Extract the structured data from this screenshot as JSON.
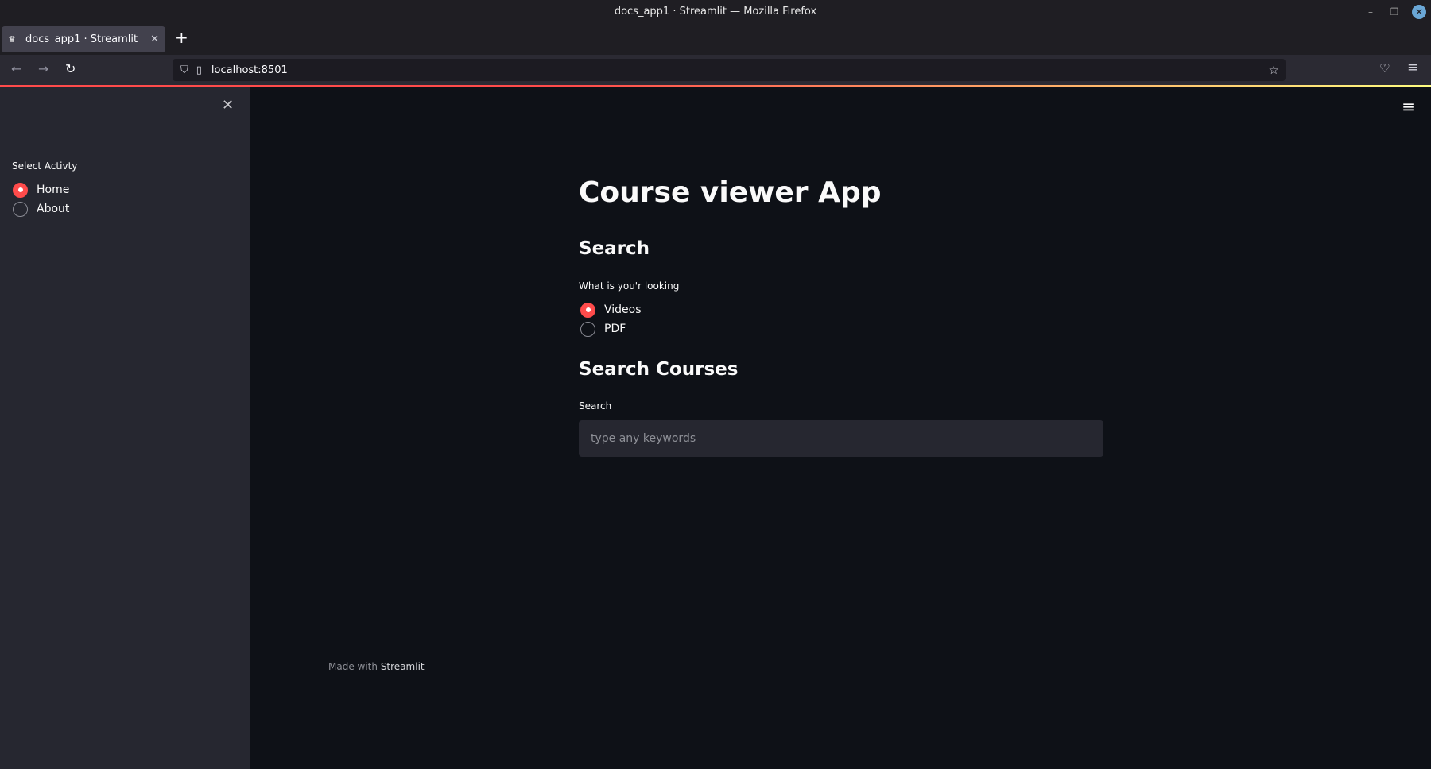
{
  "window": {
    "title": "docs_app1 · Streamlit — Mozilla Firefox",
    "controls": {
      "minimize": "–",
      "maximize": "❐",
      "close": "✕"
    }
  },
  "browser": {
    "tab": {
      "favicon": "♛",
      "title": "docs_app1 · Streamlit",
      "close": "✕"
    },
    "new_tab": "+",
    "nav": {
      "back": "←",
      "forward": "→",
      "reload": "↻"
    },
    "url": "localhost:8501",
    "icons": {
      "shield": "⛉",
      "page": "▯",
      "star": "☆",
      "pocket": "♡",
      "menu": "≡"
    }
  },
  "sidebar": {
    "close": "✕",
    "label": "Select Activty",
    "options": [
      {
        "label": "Home",
        "selected": true
      },
      {
        "label": "About",
        "selected": false
      }
    ]
  },
  "main": {
    "menu": "≡",
    "title": "Course viewer App",
    "search_heading": "Search",
    "type_label": "What is you'r looking",
    "type_options": [
      {
        "label": "Videos",
        "selected": true
      },
      {
        "label": "PDF",
        "selected": false
      }
    ],
    "courses_heading": "Search Courses",
    "search_label": "Search",
    "search_placeholder": "type any keywords",
    "search_value": ""
  },
  "footer": {
    "prefix": "Made with",
    "link": "Streamlit"
  },
  "colors": {
    "accent": "#ff4b4b",
    "background": "#0e1117",
    "sidebar": "#262730"
  }
}
